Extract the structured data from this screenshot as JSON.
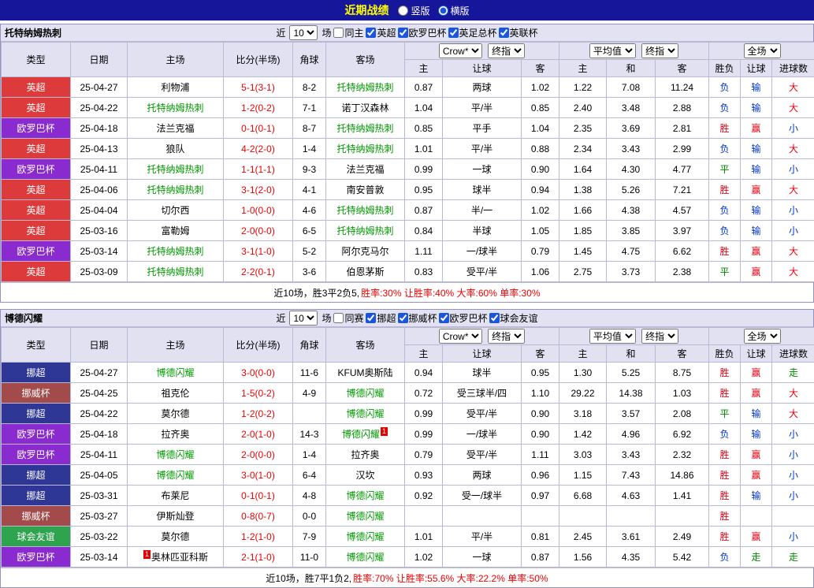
{
  "topbar": {
    "title": "近期战绩",
    "layout_options": [
      {
        "label": "竖版",
        "selected": false
      },
      {
        "label": "横版",
        "selected": true
      }
    ]
  },
  "cols": {
    "type": "类型",
    "date": "日期",
    "home": "主场",
    "score": "比分(半场)",
    "corner": "角球",
    "away": "客场",
    "odds_home": "主",
    "odds_handicap": "让球",
    "odds_away": "客",
    "avg_home": "主",
    "avg_draw": "和",
    "avg_away": "客",
    "result_wdl": "胜负",
    "result_handicap": "让球",
    "result_goals": "进球数"
  },
  "dropdowns": {
    "bookmaker": "Crow*",
    "final_odds": "终指",
    "average": "平均值",
    "final_odds2": "终指",
    "full_match": "全场"
  },
  "league_colors": {
    "英超": "#dd3b3b",
    "欧罗巴杯": "#8a2bd0",
    "挪超": "#2e3796",
    "挪威杯": "#a34a4a",
    "球会友谊": "#2ea44f"
  },
  "result_colors": {
    "胜": "#e60012",
    "赢": "#e60012",
    "大": "#e60012",
    "平": "#008800",
    "走": "#008800",
    "负": "#0033cc",
    "输": "#0033cc",
    "小": "#0033cc"
  },
  "focus_team_color": "#009900",
  "sections": [
    {
      "team": "托特纳姆热刺",
      "filter": {
        "near_label": "近",
        "count": "10",
        "games_label": "场",
        "same_label": "同主",
        "same_checked": false,
        "leagues": [
          {
            "label": "英超",
            "checked": true
          },
          {
            "label": "欧罗巴杯",
            "checked": true
          },
          {
            "label": "英足总杯",
            "checked": true
          },
          {
            "label": "英联杯",
            "checked": true
          }
        ]
      },
      "rows": [
        {
          "league": "英超",
          "date": "25-04-27",
          "home": "利物浦",
          "home_focus": false,
          "score": "5-1(3-1)",
          "corner": "8-2",
          "away": "托特纳姆热刺",
          "away_focus": true,
          "o1": "0.87",
          "hc": "两球",
          "o2": "1.02",
          "a1": "1.22",
          "a2": "7.08",
          "a3": "11.24",
          "res": [
            "负",
            "输",
            "大"
          ]
        },
        {
          "league": "英超",
          "date": "25-04-22",
          "home": "托特纳姆热刺",
          "home_focus": true,
          "score": "1-2(0-2)",
          "corner": "7-1",
          "away": "诺丁汉森林",
          "away_focus": false,
          "o1": "1.04",
          "hc": "平/半",
          "o2": "0.85",
          "a1": "2.40",
          "a2": "3.48",
          "a3": "2.88",
          "res": [
            "负",
            "输",
            "大"
          ]
        },
        {
          "league": "欧罗巴杯",
          "date": "25-04-18",
          "home": "法兰克福",
          "home_focus": false,
          "score": "0-1(0-1)",
          "corner": "8-7",
          "away": "托特纳姆热刺",
          "away_focus": true,
          "o1": "0.85",
          "hc": "平手",
          "o2": "1.04",
          "a1": "2.35",
          "a2": "3.69",
          "a3": "2.81",
          "res": [
            "胜",
            "赢",
            "小"
          ]
        },
        {
          "league": "英超",
          "date": "25-04-13",
          "home": "狼队",
          "home_focus": false,
          "score": "4-2(2-0)",
          "corner": "1-4",
          "away": "托特纳姆热刺",
          "away_focus": true,
          "o1": "1.01",
          "hc": "平/半",
          "o2": "0.88",
          "a1": "2.34",
          "a2": "3.43",
          "a3": "2.99",
          "res": [
            "负",
            "输",
            "大"
          ]
        },
        {
          "league": "欧罗巴杯",
          "date": "25-04-11",
          "home": "托特纳姆热刺",
          "home_focus": true,
          "score": "1-1(1-1)",
          "corner": "9-3",
          "away": "法兰克福",
          "away_focus": false,
          "o1": "0.99",
          "hc": "一球",
          "o2": "0.90",
          "a1": "1.64",
          "a2": "4.30",
          "a3": "4.77",
          "res": [
            "平",
            "输",
            "小"
          ]
        },
        {
          "league": "英超",
          "date": "25-04-06",
          "home": "托特纳姆热刺",
          "home_focus": true,
          "score": "3-1(2-0)",
          "corner": "4-1",
          "away": "南安普敦",
          "away_focus": false,
          "o1": "0.95",
          "hc": "球半",
          "o2": "0.94",
          "a1": "1.38",
          "a2": "5.26",
          "a3": "7.21",
          "res": [
            "胜",
            "赢",
            "大"
          ]
        },
        {
          "league": "英超",
          "date": "25-04-04",
          "home": "切尔西",
          "home_focus": false,
          "score": "1-0(0-0)",
          "corner": "4-6",
          "away": "托特纳姆热刺",
          "away_focus": true,
          "o1": "0.87",
          "hc": "半/一",
          "o2": "1.02",
          "a1": "1.66",
          "a2": "4.38",
          "a3": "4.57",
          "res": [
            "负",
            "输",
            "小"
          ]
        },
        {
          "league": "英超",
          "date": "25-03-16",
          "home": "富勒姆",
          "home_focus": false,
          "score": "2-0(0-0)",
          "corner": "6-5",
          "away": "托特纳姆热刺",
          "away_focus": true,
          "o1": "0.84",
          "hc": "半球",
          "o2": "1.05",
          "a1": "1.85",
          "a2": "3.85",
          "a3": "3.97",
          "res": [
            "负",
            "输",
            "小"
          ]
        },
        {
          "league": "欧罗巴杯",
          "date": "25-03-14",
          "home": "托特纳姆热刺",
          "home_focus": true,
          "score": "3-1(1-0)",
          "corner": "5-2",
          "away": "阿尔克马尔",
          "away_focus": false,
          "o1": "1.11",
          "hc": "一/球半",
          "o2": "0.79",
          "a1": "1.45",
          "a2": "4.75",
          "a3": "6.62",
          "res": [
            "胜",
            "赢",
            "大"
          ]
        },
        {
          "league": "英超",
          "date": "25-03-09",
          "home": "托特纳姆热刺",
          "home_focus": true,
          "score": "2-2(0-1)",
          "corner": "3-6",
          "away": "伯恩茅斯",
          "away_focus": false,
          "o1": "0.83",
          "hc": "受平/半",
          "o2": "1.06",
          "a1": "2.75",
          "a2": "3.73",
          "a3": "2.38",
          "res": [
            "平",
            "赢",
            "大"
          ]
        }
      ],
      "summary_prefix": "近10场，胜3平2负5,",
      "summary_rates": "胜率:30% 让胜率:40% 大率:60% 单率:30%"
    },
    {
      "team": "博德闪耀",
      "filter": {
        "near_label": "近",
        "count": "10",
        "games_label": "场",
        "same_label": "同赛",
        "same_checked": false,
        "leagues": [
          {
            "label": "挪超",
            "checked": true
          },
          {
            "label": "挪威杯",
            "checked": true
          },
          {
            "label": "欧罗巴杯",
            "checked": true
          },
          {
            "label": "球会友谊",
            "checked": true
          }
        ]
      },
      "rows": [
        {
          "league": "挪超",
          "date": "25-04-27",
          "home": "博德闪耀",
          "home_focus": true,
          "score": "3-0(0-0)",
          "corner": "11-6",
          "away": "KFUM奥斯陆",
          "away_focus": false,
          "o1": "0.94",
          "hc": "球半",
          "o2": "0.95",
          "a1": "1.30",
          "a2": "5.25",
          "a3": "8.75",
          "res": [
            "胜",
            "赢",
            "走"
          ]
        },
        {
          "league": "挪威杯",
          "date": "25-04-25",
          "home": "祖克伦",
          "home_focus": false,
          "score": "1-5(0-2)",
          "corner": "4-9",
          "away": "博德闪耀",
          "away_focus": true,
          "o1": "0.72",
          "hc": "受三球半/四",
          "o2": "1.10",
          "a1": "29.22",
          "a2": "14.38",
          "a3": "1.03",
          "res": [
            "胜",
            "赢",
            "大"
          ]
        },
        {
          "league": "挪超",
          "date": "25-04-22",
          "home": "莫尔德",
          "home_focus": false,
          "score": "1-2(0-2)",
          "corner": "",
          "away": "博德闪耀",
          "away_focus": true,
          "o1": "0.99",
          "hc": "受平/半",
          "o2": "0.90",
          "a1": "3.18",
          "a2": "3.57",
          "a3": "2.08",
          "res": [
            "平",
            "输",
            "大"
          ]
        },
        {
          "league": "欧罗巴杯",
          "date": "25-04-18",
          "home": "拉齐奥",
          "home_focus": false,
          "score": "2-0(1-0)",
          "corner": "14-3",
          "away": "博德闪耀",
          "away_focus": true,
          "away_card": "1",
          "o1": "0.99",
          "hc": "一/球半",
          "o2": "0.90",
          "a1": "1.42",
          "a2": "4.96",
          "a3": "6.92",
          "res": [
            "负",
            "输",
            "小"
          ]
        },
        {
          "league": "欧罗巴杯",
          "date": "25-04-11",
          "home": "博德闪耀",
          "home_focus": true,
          "score": "2-0(0-0)",
          "corner": "1-4",
          "away": "拉齐奥",
          "away_focus": false,
          "o1": "0.79",
          "hc": "受平/半",
          "o2": "1.11",
          "a1": "3.03",
          "a2": "3.43",
          "a3": "2.32",
          "res": [
            "胜",
            "赢",
            "小"
          ]
        },
        {
          "league": "挪超",
          "date": "25-04-05",
          "home": "博德闪耀",
          "home_focus": true,
          "score": "3-0(1-0)",
          "corner": "6-4",
          "away": "汉坎",
          "away_focus": false,
          "o1": "0.93",
          "hc": "两球",
          "o2": "0.96",
          "a1": "1.15",
          "a2": "7.43",
          "a3": "14.86",
          "res": [
            "胜",
            "赢",
            "小"
          ]
        },
        {
          "league": "挪超",
          "date": "25-03-31",
          "home": "布莱尼",
          "home_focus": false,
          "score": "0-1(0-1)",
          "corner": "4-8",
          "away": "博德闪耀",
          "away_focus": true,
          "o1": "0.92",
          "hc": "受一/球半",
          "o2": "0.97",
          "a1": "6.68",
          "a2": "4.63",
          "a3": "1.41",
          "res": [
            "胜",
            "输",
            "小"
          ]
        },
        {
          "league": "挪威杯",
          "date": "25-03-27",
          "home": "伊斯灿登",
          "home_focus": false,
          "score": "0-8(0-7)",
          "corner": "0-0",
          "away": "博德闪耀",
          "away_focus": true,
          "o1": "",
          "hc": "",
          "o2": "",
          "a1": "",
          "a2": "",
          "a3": "",
          "res": [
            "胜",
            "",
            ""
          ]
        },
        {
          "league": "球会友谊",
          "date": "25-03-22",
          "home": "莫尔德",
          "home_focus": false,
          "score": "1-2(1-0)",
          "corner": "7-9",
          "away": "博德闪耀",
          "away_focus": true,
          "o1": "1.01",
          "hc": "平/半",
          "o2": "0.81",
          "a1": "2.45",
          "a2": "3.61",
          "a3": "2.49",
          "res": [
            "胜",
            "赢",
            "小"
          ]
        },
        {
          "league": "欧罗巴杯",
          "date": "25-03-14",
          "home": "奥林匹亚科斯",
          "home_focus": false,
          "home_card": "1",
          "score": "2-1(1-0)",
          "corner": "11-0",
          "away": "博德闪耀",
          "away_focus": true,
          "o1": "1.02",
          "hc": "一球",
          "o2": "0.87",
          "a1": "1.56",
          "a2": "4.35",
          "a3": "5.42",
          "res": [
            "负",
            "走",
            "走"
          ]
        }
      ],
      "summary_prefix": "近10场，胜7平1负2,",
      "summary_rates": "胜率:70% 让胜率:55.6% 大率:22.2% 单率:50%"
    }
  ]
}
